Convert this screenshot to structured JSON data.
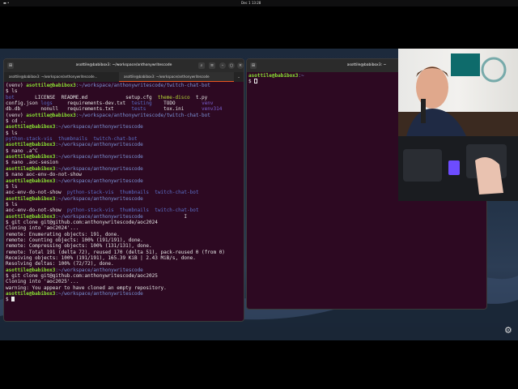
{
  "topbar": {
    "activities": "▬ •",
    "clock": "Dec 1 13:28"
  },
  "left_terminal": {
    "title": "asottile@babibox3: ~/workspace/anthonywritescode",
    "tabs": [
      {
        "label": "asottile@babibox3: ~/workspace/anthonywritescode..."
      },
      {
        "label": "asottile@babibox3: ~/workspace/anthonywritescode"
      }
    ],
    "lines": [
      [
        [
          "(venv) ",
          ""
        ],
        [
          "asottile@babibox3",
          "g"
        ],
        [
          ":~/workspace/anthonywritescode/twitch-chat-bot",
          "b"
        ]
      ],
      [
        [
          "$ ls",
          ""
        ]
      ],
      [
        [
          "bot",
          "d"
        ],
        [
          "       LICENSE  README.md             setup.cfg  ",
          ""
        ],
        [
          "theme-disco",
          "y"
        ],
        [
          "  t.py",
          ""
        ]
      ],
      [
        [
          "config.json ",
          ""
        ],
        [
          "logs",
          "d"
        ],
        [
          "     requirements-dev.txt  ",
          ""
        ],
        [
          "testing",
          "d"
        ],
        [
          "    TODO         ",
          ""
        ],
        [
          "venv",
          "v"
        ]
      ],
      [
        [
          "db.db       nonull   requirements.txt      ",
          ""
        ],
        [
          "tests",
          "d"
        ],
        [
          "      tox.ini      ",
          ""
        ],
        [
          "venv314",
          "v"
        ]
      ],
      [
        [
          "(venv) ",
          ""
        ],
        [
          "asottile@babibox3",
          "g"
        ],
        [
          ":~/workspace/anthonywritescode/twitch-chat-bot",
          "b"
        ]
      ],
      [
        [
          "$ cd ..",
          ""
        ]
      ],
      [
        [
          "asottile@babibox3",
          "g"
        ],
        [
          ":~/workspace/anthonywritescode",
          "b"
        ]
      ],
      [
        [
          "$ ls",
          ""
        ]
      ],
      [
        [
          "python-stack-vis",
          "d"
        ],
        [
          "  ",
          ""
        ],
        [
          "thumbnails",
          "d"
        ],
        [
          "  ",
          ""
        ],
        [
          "twitch-chat-bot",
          "d"
        ]
      ],
      [
        [
          "asottile@babibox3",
          "g"
        ],
        [
          ":~/workspace/anthonywritescode",
          "b"
        ]
      ],
      [
        [
          "$ nano .a^C",
          ""
        ]
      ],
      [
        [
          "asottile@babibox3",
          "g"
        ],
        [
          ":~/workspace/anthonywritescode",
          "b"
        ]
      ],
      [
        [
          "$ nano .aoc-sesion",
          ""
        ]
      ],
      [
        [
          "asottile@babibox3",
          "g"
        ],
        [
          ":~/workspace/anthonywritescode",
          "b"
        ]
      ],
      [
        [
          "$ nano aoc-env-do-not-show",
          ""
        ]
      ],
      [
        [
          "asottile@babibox3",
          "g"
        ],
        [
          ":~/workspace/anthonywritescode",
          "b"
        ]
      ],
      [
        [
          "$ ls",
          ""
        ]
      ],
      [
        [
          "aoc-env-do-not-show  ",
          ""
        ],
        [
          "python-stack-vis",
          "d"
        ],
        [
          "  ",
          ""
        ],
        [
          "thumbnails",
          "d"
        ],
        [
          "  ",
          ""
        ],
        [
          "twitch-chat-bot",
          "d"
        ]
      ],
      [
        [
          "asottile@babibox3",
          "g"
        ],
        [
          ":~/workspace/anthonywritescode",
          "b"
        ]
      ],
      [
        [
          "$ ls",
          ""
        ]
      ],
      [
        [
          "aoc-env-do-not-show  ",
          ""
        ],
        [
          "python-stack-vis",
          "d"
        ],
        [
          "  ",
          ""
        ],
        [
          "thumbnails",
          "d"
        ],
        [
          "  ",
          ""
        ],
        [
          "twitch-chat-bot",
          "d"
        ]
      ],
      [
        [
          "asottile@babibox3",
          "g"
        ],
        [
          ":~/workspace/anthonywritescode",
          "b"
        ],
        [
          "              I",
          ""
        ]
      ],
      [
        [
          "$ git clone git@github.com:anthonywritescode/aoc2024",
          ""
        ]
      ],
      [
        [
          "Cloning into 'aoc2024'...",
          ""
        ]
      ],
      [
        [
          "remote: Enumerating objects: 191, done.",
          ""
        ]
      ],
      [
        [
          "remote: Counting objects: 100% (191/191), done.",
          ""
        ]
      ],
      [
        [
          "remote: Compressing objects: 100% (131/131), done.",
          ""
        ]
      ],
      [
        [
          "remote: Total 191 (delta 72), reused 170 (delta 51), pack-reused 0 (from 0)",
          ""
        ]
      ],
      [
        [
          "Receiving objects: 100% (191/191), 165.39 KiB | 2.43 MiB/s, done.",
          ""
        ]
      ],
      [
        [
          "Resolving deltas: 100% (72/72), done.",
          ""
        ]
      ],
      [
        [
          "asottile@babibox3",
          "g"
        ],
        [
          ":~/workspace/anthonywritescode",
          "b"
        ]
      ],
      [
        [
          "$ git clone git@github.com:anthonywritescode/aoc2025",
          ""
        ]
      ],
      [
        [
          "Cloning into 'aoc2025'...",
          ""
        ]
      ],
      [
        [
          "warning: You appear to have cloned an empty repository.",
          ""
        ]
      ],
      [
        [
          "asottile@babibox3",
          "g"
        ],
        [
          ":~/workspace/anthonywritescode",
          "b"
        ]
      ],
      [
        [
          "$ ",
          ""
        ]
      ]
    ]
  },
  "right_terminal": {
    "title": "asottile@babibox3: ~",
    "lines": [
      [
        [
          "asottile@babibox3",
          "g"
        ],
        [
          ":~",
          "b"
        ]
      ],
      [
        [
          "$ ",
          ""
        ]
      ]
    ]
  },
  "icons": {
    "new_tab": "⊞",
    "search": "⌕",
    "menu": "≡",
    "minimize": "–",
    "maximize": "○",
    "close": "×",
    "tab_menu": "⌄",
    "settings": "⚙"
  }
}
